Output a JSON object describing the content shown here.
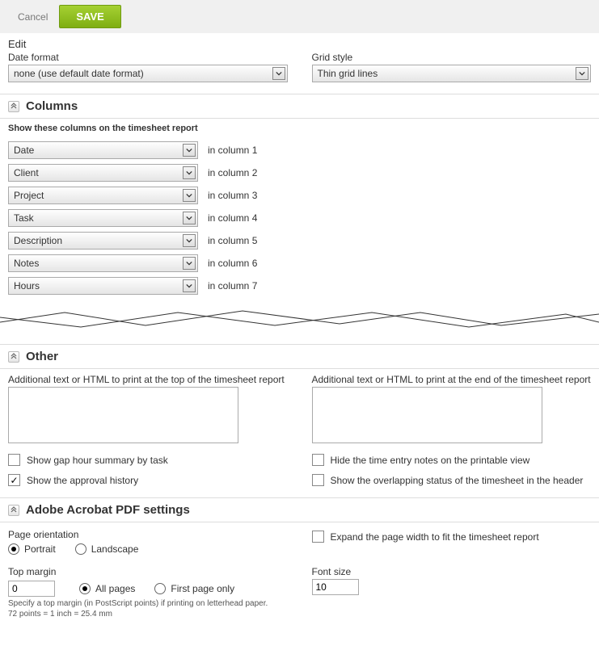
{
  "topbar": {
    "cancel": "Cancel",
    "save": "SAVE"
  },
  "edit": {
    "title": "Edit",
    "date_format_label": "Date format",
    "date_format_value": "none (use default date format)",
    "grid_style_label": "Grid style",
    "grid_style_value": "Thin grid lines"
  },
  "columns": {
    "title": "Columns",
    "help": "Show these columns on the timesheet report",
    "rows": [
      {
        "value": "Date",
        "text": "in column 1"
      },
      {
        "value": "Client",
        "text": "in column 2"
      },
      {
        "value": "Project",
        "text": "in column 3"
      },
      {
        "value": "Task",
        "text": "in column 4"
      },
      {
        "value": "Description",
        "text": "in column 5"
      },
      {
        "value": "Notes",
        "text": "in column 6"
      },
      {
        "value": "Hours",
        "text": "in column 7"
      }
    ]
  },
  "other": {
    "title": "Other",
    "top_html_label": "Additional text or HTML to print at the top of the timesheet report",
    "end_html_label": "Additional text or HTML to print at the end of the timesheet report",
    "chk_gap": "Show gap hour summary by task",
    "chk_approval": "Show the approval history",
    "chk_hide_notes": "Hide the time entry notes on the printable view",
    "chk_overlap": "Show the overlapping status of the timesheet in the header"
  },
  "pdf": {
    "title": "Adobe Acrobat PDF settings",
    "orientation_label": "Page orientation",
    "portrait": "Portrait",
    "landscape": "Landscape",
    "expand": "Expand the page width to fit the timesheet report",
    "top_margin_label": "Top margin",
    "top_margin_value": "0",
    "all_pages": "All pages",
    "first_page": "First page only",
    "margin_hint": "Specify a top margin (in PostScript points) if printing on letterhead paper.\n72 points = 1 inch = 25.4 mm",
    "font_size_label": "Font size",
    "font_size_value": "10"
  }
}
